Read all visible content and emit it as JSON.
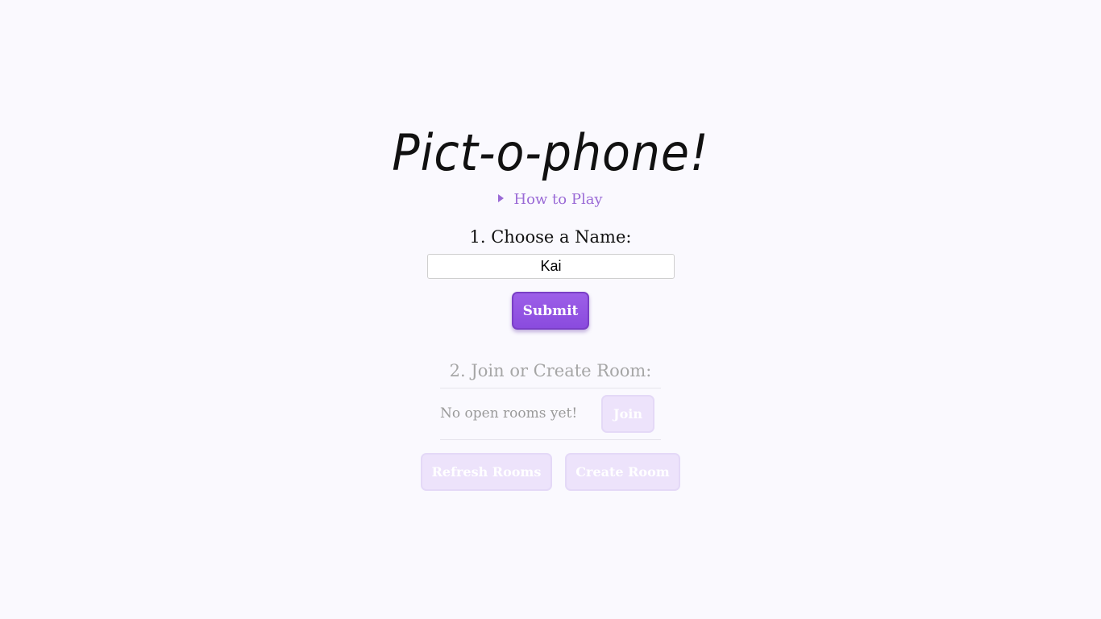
{
  "app": {
    "title": "Pict-o-phone!"
  },
  "how_to_play": {
    "label": "How to Play",
    "icon": "disclosure-triangle-icon"
  },
  "step1": {
    "heading": "1. Choose a Name:",
    "name_value": "Kai",
    "submit_label": "Submit"
  },
  "step2": {
    "heading": "2. Join or Create Room:",
    "empty_message": "No open rooms yet!",
    "join_label": "Join",
    "refresh_label": "Refresh Rooms",
    "create_label": "Create Room"
  },
  "colors": {
    "accent": "#8a4bde",
    "link": "#9a6ad6",
    "disabled_button": "#ede3fb",
    "background": "#faf9fe"
  }
}
